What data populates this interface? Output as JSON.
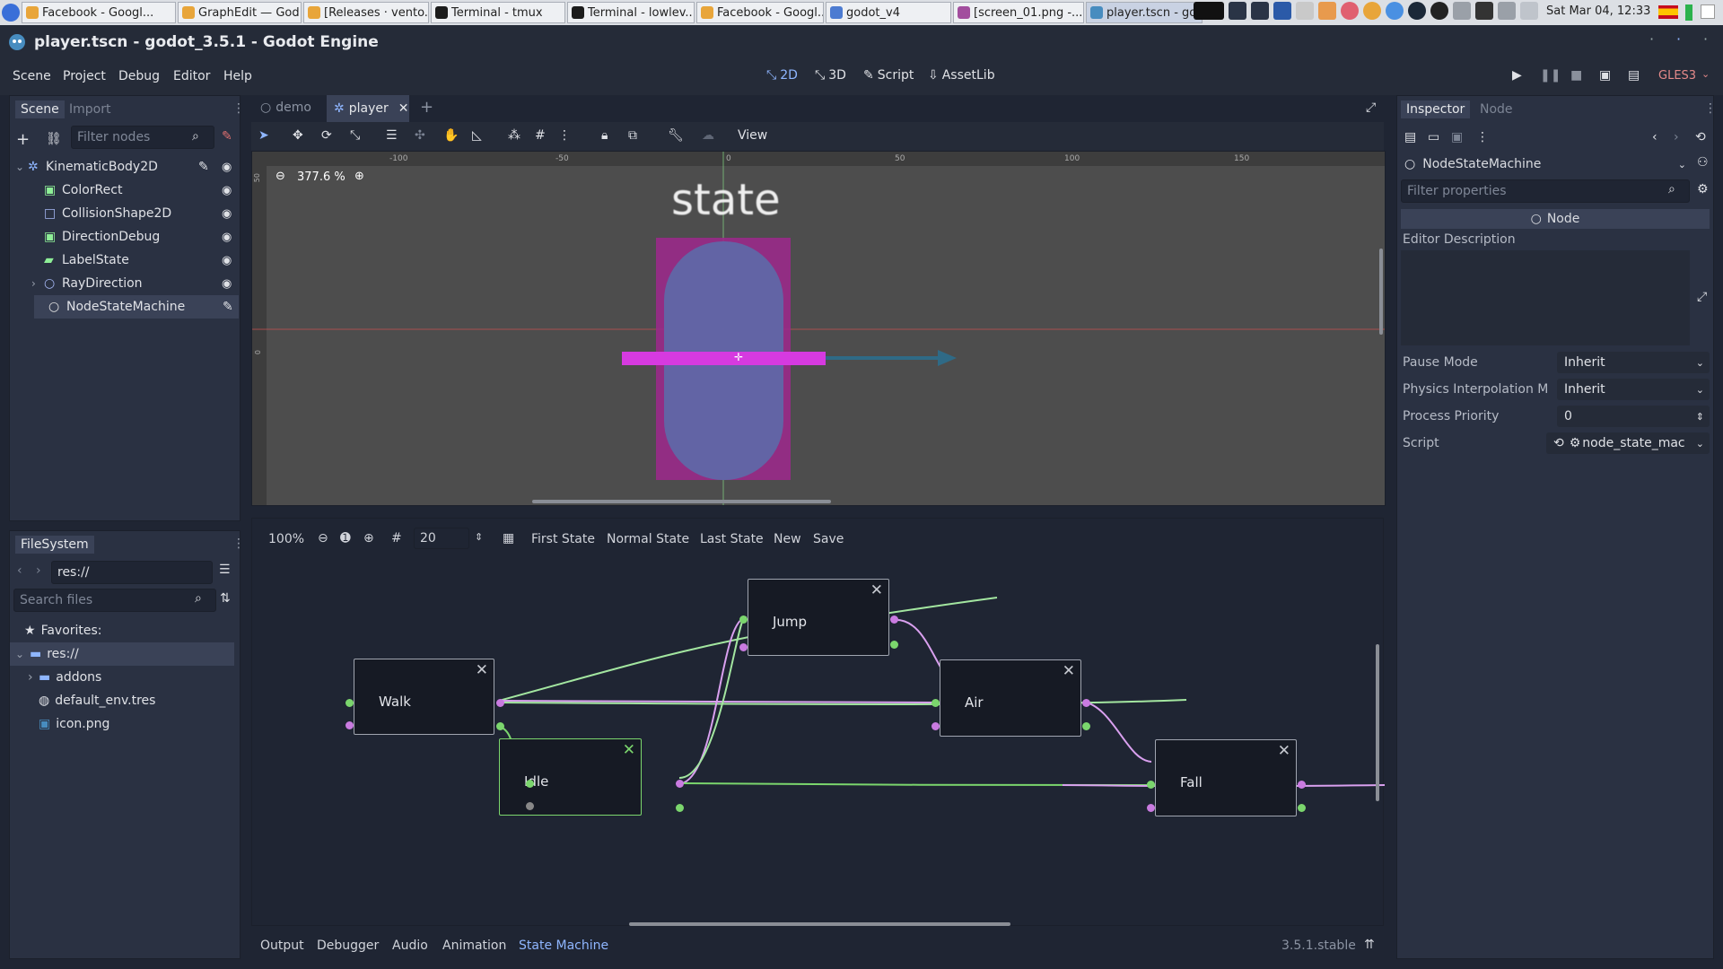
{
  "taskbar": {
    "tabs": [
      {
        "label": "Facebook - Googl...",
        "color": "#e8a53a"
      },
      {
        "label": "GraphEdit — God...",
        "color": "#e8a53a"
      },
      {
        "label": "[Releases · vento...",
        "color": "#e8a53a"
      },
      {
        "label": "Terminal - tmux",
        "color": "#1c1c1c"
      },
      {
        "label": "Terminal - lowlev...",
        "color": "#1c1c1c"
      },
      {
        "label": "Facebook - Googl...",
        "color": "#e8a53a"
      },
      {
        "label": "godot_v4",
        "color": "#4c7bd1"
      },
      {
        "label": "[screen_01.png -...",
        "color": "#a24e9e"
      },
      {
        "label": "player.tscn - god...",
        "color": "#478cbf"
      }
    ],
    "clock": "Sat Mar 04, 12:33"
  },
  "window": {
    "title": "player.tscn - godot_3.5.1 - Godot Engine"
  },
  "menu": {
    "items": [
      "Scene",
      "Project",
      "Debug",
      "Editor",
      "Help"
    ],
    "workspaces": {
      "two_d": "2D",
      "three_d": "3D",
      "script": "Script",
      "assetlib": "AssetLib"
    },
    "renderer": "GLES3"
  },
  "scene_dock": {
    "tab_scene": "Scene",
    "tab_import": "Import",
    "filter_placeholder": "Filter nodes",
    "nodes": [
      {
        "name": "KinematicBody2D",
        "type": "kinematic-body",
        "depth": 0
      },
      {
        "name": "ColorRect",
        "type": "color-rect",
        "depth": 1
      },
      {
        "name": "CollisionShape2D",
        "type": "collision-shape",
        "depth": 1
      },
      {
        "name": "DirectionDebug",
        "type": "color-rect",
        "depth": 1
      },
      {
        "name": "LabelState",
        "type": "label",
        "depth": 1
      },
      {
        "name": "RayDirection",
        "type": "raycast",
        "depth": 1
      },
      {
        "name": "NodeStateMachine",
        "type": "node",
        "depth": 1
      }
    ]
  },
  "filesystem_dock": {
    "title": "FileSystem",
    "path": "res://",
    "search_placeholder": "Search files",
    "favorites": "Favorites:",
    "items": [
      "res://",
      "addons",
      "default_env.tres",
      "icon.png"
    ]
  },
  "editor_tabs": [
    {
      "label": "demo"
    },
    {
      "label": "player"
    }
  ],
  "viewport": {
    "zoom": "377.6 %",
    "menu_view": "View",
    "label_text": "state",
    "ruler_labels": [
      "-100",
      "-50",
      "0",
      "50",
      "100",
      "150"
    ],
    "vertical_ruler_labels": [
      "50",
      "0"
    ]
  },
  "state_machine": {
    "zoom": "100%",
    "snap": "20",
    "buttons": [
      "First State",
      "Normal State",
      "Last State",
      "New",
      "Save"
    ],
    "nodes": [
      {
        "id": "walk",
        "label": "Walk"
      },
      {
        "id": "idle",
        "label": "Idle"
      },
      {
        "id": "jump",
        "label": "Jump"
      },
      {
        "id": "air",
        "label": "Air"
      },
      {
        "id": "fall",
        "label": "Fall"
      }
    ]
  },
  "bottom_panel": {
    "tabs": [
      "Output",
      "Debugger",
      "Audio",
      "Animation",
      "State Machine"
    ],
    "version": "3.5.1.stable"
  },
  "inspector": {
    "tab_inspector": "Inspector",
    "tab_node": "Node",
    "object": "NodeStateMachine",
    "filter_placeholder": "Filter properties",
    "section": "Node",
    "editor_description": "Editor Description",
    "properties": [
      {
        "name": "Pause Mode",
        "value": "Inherit"
      },
      {
        "name": "Physics Interpolation M",
        "value": "Inherit"
      },
      {
        "name": "Process Priority",
        "value": "0"
      },
      {
        "name": "Script",
        "value": "node_state_mac"
      }
    ]
  },
  "colors": {
    "accent": "#8fb6ff",
    "port_green": "#7bd66d",
    "port_purple": "#c97be0",
    "link_green": "#a3e6a0",
    "link_purple": "#d9a0ef"
  }
}
